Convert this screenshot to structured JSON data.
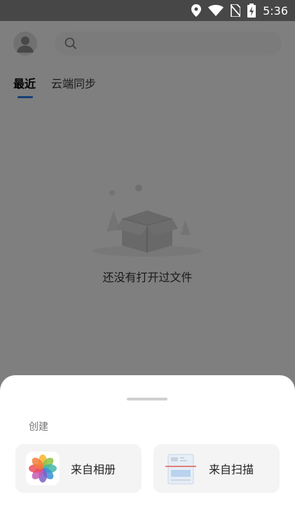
{
  "status_bar": {
    "time": "5:36",
    "icons": [
      "location-icon",
      "wifi-icon",
      "no-sim-icon",
      "battery-charging-icon"
    ]
  },
  "header": {
    "avatar_icon": "user-avatar-icon",
    "search_icon": "search-icon",
    "search_placeholder": ""
  },
  "tabs": [
    {
      "label": "最近",
      "active": true
    },
    {
      "label": "云端同步",
      "active": false
    }
  ],
  "empty_state": {
    "icon": "empty-box-icon",
    "message": "还没有打开过文件"
  },
  "bottom_sheet": {
    "section_label": "创建",
    "actions": [
      {
        "label": "来自相册",
        "icon": "photos-icon"
      },
      {
        "label": "来自扫描",
        "icon": "scan-document-icon"
      }
    ]
  },
  "colors": {
    "accent": "#2a7be0",
    "scrim": "rgba(0,0,0,0.48)",
    "sheet_background": "#ffffff",
    "card_background": "#f4f4f5"
  }
}
